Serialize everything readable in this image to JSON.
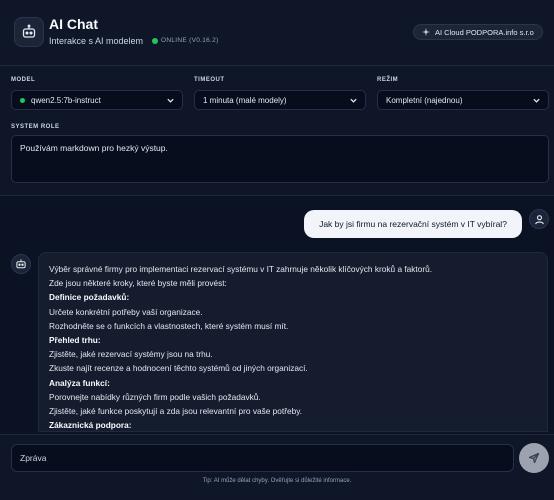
{
  "app": {
    "title": "AI Chat",
    "subtitle": "Interakce s AI modelem",
    "status": "ONLINE (V0.16.2)",
    "brand": "AI Cloud PODPORA.info s.r.o",
    "logo_icon": "robot-icon",
    "brand_icon": "sparkle-icon"
  },
  "settings": {
    "model_label": "MODEL",
    "model_value": "qwen2.5:7b-instruct",
    "timeout_label": "TIMEOUT",
    "timeout_value": "1 minuta (malé modely)",
    "mode_label": "REŽIM",
    "mode_value": "Kompletní (najednou)",
    "system_role_label": "SYSTEM ROLE",
    "system_role_value": "Používám markdown pro hezký výstup."
  },
  "chat": {
    "user_message": "Jak by jsi firmu na rezervační systém v IT vybíral?",
    "ai_lines": [
      {
        "text": "Výběr správné firmy pro implementaci rezervací systému v IT zahrnuje několik klíčových kroků a faktorů.",
        "bold": false
      },
      {
        "text": "Zde jsou některé kroky, které byste měli provést:",
        "bold": false
      },
      {
        "text": "Definice požadavků:",
        "bold": true
      },
      {
        "text": "Určete konkrétní potřeby vaší organizace.",
        "bold": false
      },
      {
        "text": "Rozhodněte se o funkcích a vlastnostech, které systém musí mít.",
        "bold": false
      },
      {
        "text": "Přehled trhu:",
        "bold": true
      },
      {
        "text": "Zjistěte, jaké rezervací systémy jsou na trhu.",
        "bold": false
      },
      {
        "text": "Zkuste najít recenze a hodnocení těchto systémů od jiných organizací.",
        "bold": false
      },
      {
        "text": "Analýza funkcí:",
        "bold": true
      },
      {
        "text": "Porovnejte nabídky různých firm podle vašich požadavků.",
        "bold": false
      },
      {
        "text": "Zjistěte, jaké funkce poskytují a zda jsou relevantní pro vaše potřeby.",
        "bold": false
      },
      {
        "text": "Zákaznická podpora:",
        "bold": true
      }
    ]
  },
  "composer": {
    "placeholder": "Zpráva",
    "tip": "Tip: AI může dělat chyby. Ověřujte si důležité informace.",
    "send_icon": "send-icon"
  },
  "colors": {
    "background": "#0b1224",
    "panel": "#0e1628",
    "online": "#22c55e",
    "user_bubble": "#f1f5f9",
    "ai_bubble": "#141c2e",
    "send_button": "#9ca3af"
  }
}
